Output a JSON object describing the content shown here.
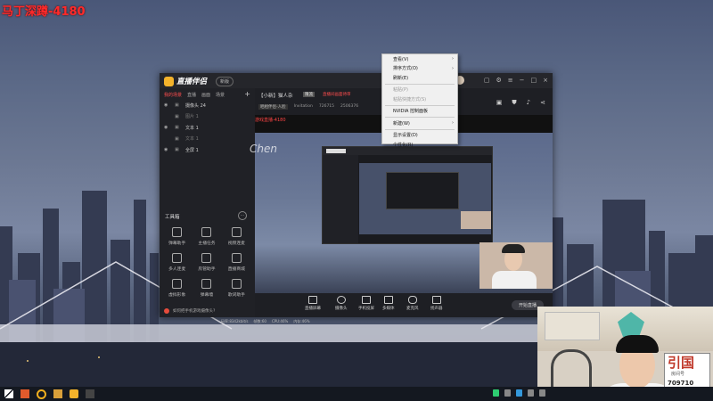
{
  "overlay": {
    "streamer_watermark": "马丁深蹲-4180",
    "signature_text": "Chen"
  },
  "app": {
    "name": "直播伴侣",
    "version_badge": "新版",
    "sidebar_tabs": [
      "我的场景",
      "直播",
      "画面",
      "场景"
    ],
    "sources": [
      {
        "label": "摄像头 24",
        "dim": false
      },
      {
        "label": "图片 1",
        "dim": true
      },
      {
        "label": "文本 1",
        "dim": false
      },
      {
        "label": "文本 1",
        "dim": true
      },
      {
        "label": "全屏 1",
        "dim": false
      }
    ],
    "toolbox_title": "工具箱",
    "tools": [
      {
        "label": "弹幕助手",
        "badge": ""
      },
      {
        "label": "主播任务",
        "badge": ""
      },
      {
        "label": "视频连麦",
        "badge": ""
      },
      {
        "label": "多人连麦",
        "badge": ""
      },
      {
        "label": "房管助手",
        "badge": ""
      },
      {
        "label": "直播商城",
        "badge": ""
      },
      {
        "label": "虚拟形象",
        "badge": ""
      },
      {
        "label": "弹幕墙",
        "badge": ""
      },
      {
        "label": "歌词助手",
        "badge": ""
      }
    ],
    "sidebar_bottom": "如何把手机游戏摄像头?",
    "room_title": "【小新】猫人杂",
    "room_tag": "限流",
    "room_tag2": "直播间画面待审",
    "room_meta": [
      "晒相伴侣-人脸",
      "Invitation",
      "726715",
      "2506376"
    ],
    "canvas_label": "游戏直播-4180",
    "controls": [
      "直播屏幕",
      "摄像头",
      "手机投屏",
      "多媒体",
      "麦克风",
      "扬声器"
    ],
    "start_button": "开始直播",
    "status_bar": [
      "码率:8342kbit/s",
      "帧数:60",
      "CPU:46%",
      "内存:46%"
    ]
  },
  "context_menu": {
    "items": [
      {
        "label": "查看(V)",
        "submenu": true,
        "disabled": false
      },
      {
        "label": "排序方式(O)",
        "submenu": true,
        "disabled": false
      },
      {
        "label": "刷新(E)",
        "submenu": false,
        "disabled": false
      },
      {
        "label": "---"
      },
      {
        "label": "粘贴(P)",
        "submenu": false,
        "disabled": true
      },
      {
        "label": "粘贴快捷方式(S)",
        "submenu": false,
        "disabled": true
      },
      {
        "label": "---"
      },
      {
        "label": "NVIDIA 控制面板",
        "submenu": false,
        "disabled": false
      },
      {
        "label": "---"
      },
      {
        "label": "新建(W)",
        "submenu": true,
        "disabled": false
      },
      {
        "label": "---"
      },
      {
        "label": "显示设置(D)",
        "submenu": false,
        "disabled": false
      },
      {
        "label": "个性化(R)",
        "submenu": false,
        "disabled": false
      }
    ]
  },
  "webcam": {
    "tag_logo": "引国",
    "tag_text": "房间号",
    "room_number": "709710"
  },
  "colors": {
    "accent": "#ff4d4d",
    "watermark": "#ff2a2a",
    "app_bg": "#1b1c20"
  }
}
